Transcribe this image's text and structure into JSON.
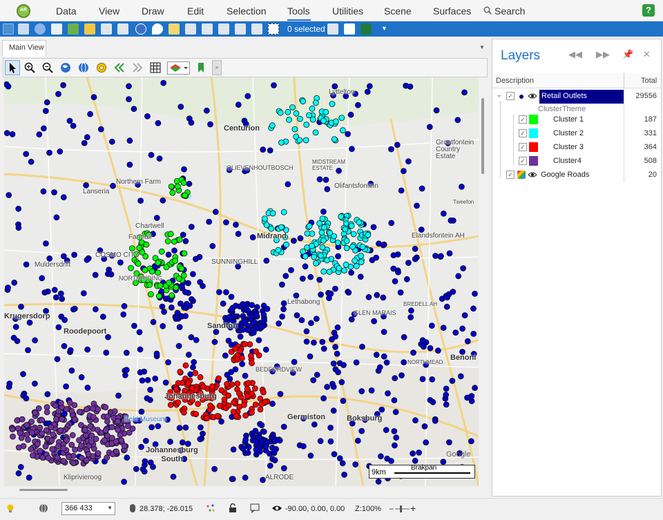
{
  "menu": {
    "items": [
      "Data",
      "View",
      "Draw",
      "Edit",
      "Selection",
      "Tools",
      "Utilities",
      "Scene",
      "Surfaces"
    ],
    "search_label": "Search",
    "active": "Tools",
    "logo_text": "AR"
  },
  "toolbar": {
    "selected_count": "0 selected",
    "icons": [
      "folder-icon",
      "database-icon",
      "globe-icon",
      "layers-icon",
      "map-icon",
      "image-icon",
      "measure-icon",
      "compass-icon",
      "world-icon",
      "pin-icon",
      "select-rect-icon",
      "select-arrow-icon",
      "select-polygon-icon",
      "select-circle-icon",
      "select-line-icon",
      "clear-selection-icon",
      "filter-icon",
      "table-icon",
      "excel-export-icon"
    ]
  },
  "tabs": {
    "main_view": "Main View"
  },
  "map_tools": [
    "pointer-icon",
    "zoom-in-icon",
    "zoom-out-icon",
    "world-view-icon",
    "globe-grid-icon",
    "settings-gear-icon",
    "back-icon",
    "forward-icon",
    "grid-icon",
    "layer-style-icon",
    "bookmark-icon"
  ],
  "map": {
    "places": [
      {
        "name": "Lyttelton",
        "big": false
      },
      {
        "name": "Centurion",
        "big": true
      },
      {
        "name": "OLIEVENHOUTBOSCH",
        "big": false
      },
      {
        "name": "MIDSTREAM ESTATE",
        "big": false
      },
      {
        "name": "Olifantsfontein",
        "big": false
      },
      {
        "name": "Grootfontein Country Estate",
        "big": false
      },
      {
        "name": "Northern Farm",
        "big": false
      },
      {
        "name": "Lanseria",
        "big": false
      },
      {
        "name": "Chartwell",
        "big": false
      },
      {
        "name": "Farmall",
        "big": false
      },
      {
        "name": "COSMO CITY",
        "big": false
      },
      {
        "name": "Midrand",
        "big": true
      },
      {
        "name": "Elandsfontein AH",
        "big": false
      },
      {
        "name": "SUNNINGHILL",
        "big": false
      },
      {
        "name": "NORTHRIDING",
        "big": false
      },
      {
        "name": "Muldersdrift",
        "big": false
      },
      {
        "name": "Lethabong",
        "big": false
      },
      {
        "name": "GLEN MARAIS",
        "big": false
      },
      {
        "name": "BREDELL AH",
        "big": false
      },
      {
        "name": "Roodepoort",
        "big": true
      },
      {
        "name": "Sandton",
        "big": true
      },
      {
        "name": "Krugersdorp",
        "big": true
      },
      {
        "name": "Benoni",
        "big": true
      },
      {
        "name": "NORTHMEAD",
        "big": false
      },
      {
        "name": "BEDFORDVIEW",
        "big": false
      },
      {
        "name": "Johannesburg",
        "big": true
      },
      {
        "name": "Germiston",
        "big": true
      },
      {
        "name": "Boksburg",
        "big": true
      },
      {
        "name": "Johannesburg South",
        "big": true
      },
      {
        "name": "Kliprivieroog",
        "big": false
      },
      {
        "name": "ALRODE",
        "big": false
      },
      {
        "name": "Eeld Museum",
        "big": false
      },
      {
        "name": "Tweefon",
        "big": false
      }
    ],
    "scale_bar": {
      "label": "9km",
      "town": "Brakpan"
    },
    "attribution": "Google",
    "colors": {
      "cluster_1": "#00ff00",
      "cluster_2": "#00ffff",
      "cluster_3": "#ff0000",
      "cluster_4": "#7030a0",
      "unclustered": "#0000cc"
    }
  },
  "layers": {
    "title": "Layers",
    "columns": {
      "description": "Description",
      "total": "Total"
    },
    "rows": [
      {
        "label": "Retail Outlets",
        "total": "29556",
        "level": 0
      },
      {
        "label": "ClusterTheme",
        "total": "",
        "level": 1
      },
      {
        "label": "Cluster 1",
        "total": "187",
        "color": "#00ff00",
        "level": 2
      },
      {
        "label": "Cluster 2",
        "total": "331",
        "color": "#00ffff",
        "level": 2
      },
      {
        "label": "Cluster 3",
        "total": "364",
        "color": "#ff0000",
        "level": 2
      },
      {
        "label": "Cluster4",
        "total": "508",
        "color": "#7030a0",
        "level": 2
      },
      {
        "label": "Google Roads",
        "total": "20",
        "level": 0
      }
    ]
  },
  "status": {
    "scale_value": "366 433",
    "coordinates": "28.378; -26.015",
    "view_angles": "-90.00, 0.00, 0.00",
    "zoom": "Z:100%"
  }
}
